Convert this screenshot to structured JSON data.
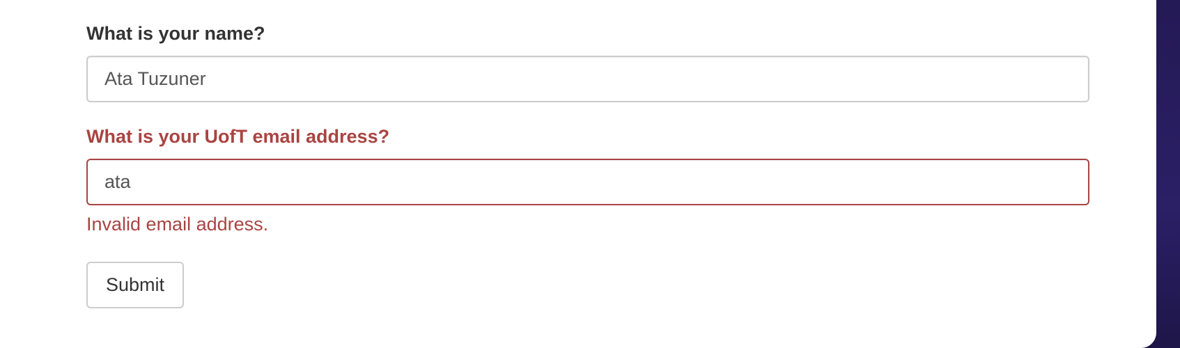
{
  "form": {
    "name_label": "What is your name?",
    "name_value": "Ata Tuzuner",
    "email_label": "What is your UofT email address?",
    "email_value": "ata",
    "email_error": "Invalid email address.",
    "submit_label": "Submit"
  },
  "colors": {
    "error": "#a94442",
    "label": "#333333",
    "border": "#cccccc",
    "background_outer": "#2b1f66"
  }
}
